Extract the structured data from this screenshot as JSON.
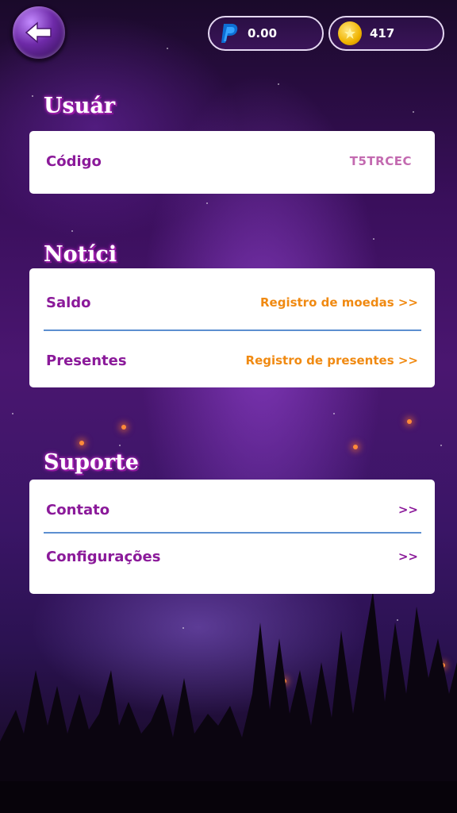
{
  "header": {
    "paypal_balance": "0.00",
    "coin_balance": "417"
  },
  "sections": {
    "user": {
      "title": "Usuár",
      "code_label": "Código",
      "code_value": "T5TRCEC"
    },
    "news": {
      "title": "Notíci",
      "balance_label": "Saldo",
      "balance_link": "Registro de moedas >>",
      "gifts_label": "Presentes",
      "gifts_link": "Registro de presentes >>"
    },
    "support": {
      "title": "Suporte",
      "contact_label": "Contato",
      "contact_arrow": ">>",
      "settings_label": "Configurações",
      "settings_arrow": ">>"
    }
  },
  "colors": {
    "label": "#8b1a9a",
    "link": "#f08a12",
    "divider": "#5c8fd0",
    "title_glow": "#c62fd1"
  }
}
